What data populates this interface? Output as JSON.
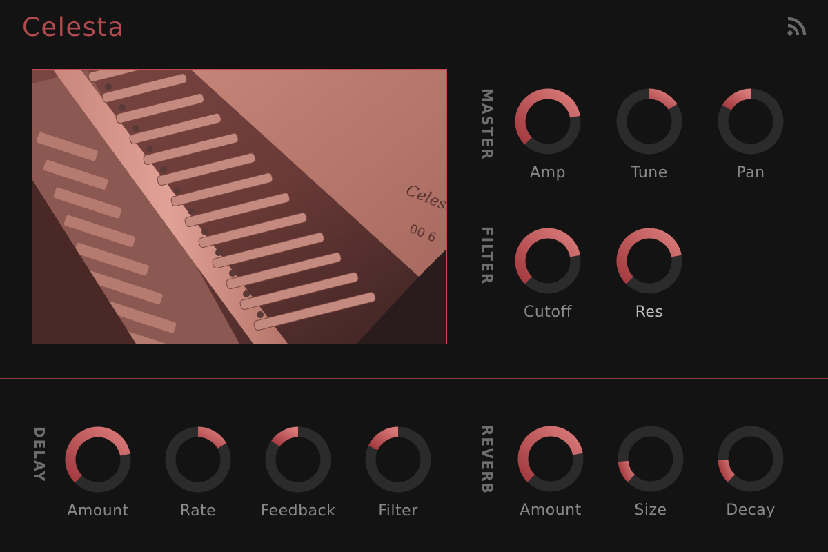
{
  "header": {
    "title": "Celesta"
  },
  "icons": {
    "top_right": "rss-icon"
  },
  "colors": {
    "accent": "#b24b4f",
    "arc_start": "#a33a3f",
    "arc_end": "#d97a7a",
    "track": "#2b2b2b",
    "background": "#131313",
    "label": "#8a8a8a",
    "section_label": "#6e6e6e"
  },
  "image": {
    "subject": "celesta-mechanism-photo",
    "plate_text": "Celesta",
    "plate_number": "00 6"
  },
  "sections": {
    "master": {
      "label": "MASTER",
      "knobs": [
        {
          "id": "amp",
          "label": "Amp",
          "start_deg": 225,
          "end_deg": 80
        },
        {
          "id": "tune",
          "label": "Tune",
          "start_deg": 0,
          "end_deg": 58
        },
        {
          "id": "pan",
          "label": "Pan",
          "start_deg": 300,
          "end_deg": 0
        }
      ]
    },
    "filter": {
      "label": "FILTER",
      "knobs": [
        {
          "id": "cutoff",
          "label": "Cutoff",
          "start_deg": 225,
          "end_deg": 80
        },
        {
          "id": "res",
          "label": "Res",
          "start_deg": 225,
          "end_deg": 80
        }
      ]
    },
    "delay": {
      "label": "DELAY",
      "knobs": [
        {
          "id": "delay_amount",
          "label": "Amount",
          "start_deg": 225,
          "end_deg": 80
        },
        {
          "id": "rate",
          "label": "Rate",
          "start_deg": 0,
          "end_deg": 60
        },
        {
          "id": "feedback",
          "label": "Feedback",
          "start_deg": 305,
          "end_deg": 0
        },
        {
          "id": "delay_filter",
          "label": "Filter",
          "start_deg": 295,
          "end_deg": 0
        }
      ]
    },
    "reverb": {
      "label": "REVERB",
      "knobs": [
        {
          "id": "reverb_amount",
          "label": "Amount",
          "start_deg": 225,
          "end_deg": 80
        },
        {
          "id": "size",
          "label": "Size",
          "start_deg": 225,
          "end_deg": 265
        },
        {
          "id": "decay",
          "label": "Decay",
          "start_deg": 225,
          "end_deg": 268
        }
      ]
    }
  }
}
